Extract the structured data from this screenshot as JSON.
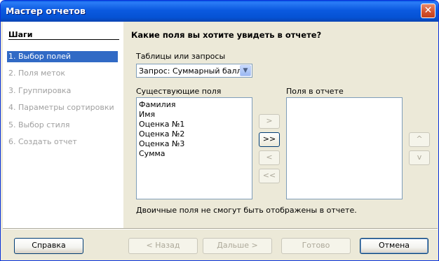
{
  "window": {
    "title": "Мастер отчетов",
    "close_label": "✕"
  },
  "sidebar": {
    "title": "Шаги",
    "steps": [
      "1. Выбор полей",
      "2. Поля меток",
      "3. Группировка",
      "4. Параметры сортировки",
      "5. Выбор стиля",
      "6. Создать отчет"
    ],
    "active_step": 0
  },
  "main": {
    "heading": "Какие поля вы хотите увидеть в отчете?",
    "tables_label": "Таблицы или запросы",
    "tables_selected": "Запрос: Суммарный балл",
    "existing_label": "Существующие поля",
    "existing_fields": [
      "Фамилия",
      "Имя",
      "Оценка №1",
      "Оценка №2",
      "Оценка №3",
      "Сумма"
    ],
    "report_label": "Поля в отчете",
    "report_fields": [],
    "move_buttons": {
      "add_one": ">",
      "add_all": ">>",
      "remove_one": "<",
      "remove_all": "<<"
    },
    "order_buttons": {
      "up": "^",
      "down": "v"
    },
    "footnote": "Двоичные поля не смогут быть отображены в отчете."
  },
  "footer": {
    "help": "Справка",
    "back": "< Назад",
    "next": "Дальше >",
    "finish": "Готово",
    "cancel": "Отмена"
  }
}
